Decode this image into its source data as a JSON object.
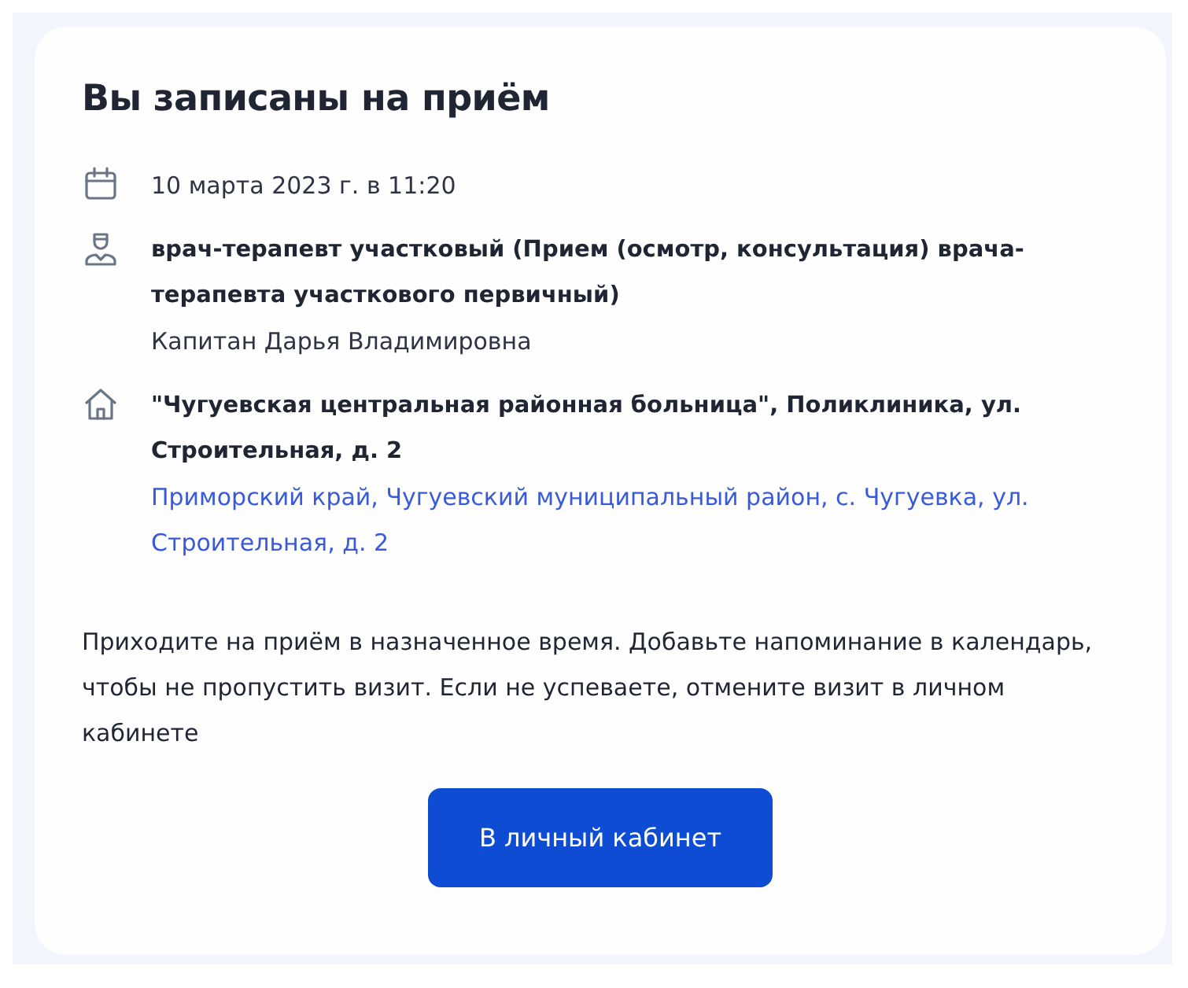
{
  "card": {
    "title": "Вы записаны на приём",
    "details": [
      {
        "kind": "date",
        "lines": [
          {
            "kind": "plain",
            "text": "10 марта 2023 г. в 11:20"
          }
        ]
      },
      {
        "kind": "doctor",
        "lines": [
          {
            "kind": "bold",
            "text": "врач-терапевт участковый (Прием (осмотр, консультация) врача-терапевта участкового первичный)"
          },
          {
            "kind": "plain",
            "text": "Капитан Дарья Владимировна"
          }
        ]
      },
      {
        "kind": "place",
        "lines": [
          {
            "kind": "bold",
            "text": "\"Чугуевская центральная районная больница\", Поликлиника, ул. Строительная, д. 2"
          },
          {
            "kind": "link",
            "text": "Приморский край, Чугуевский муниципальный район, с. Чугуевка, ул. Строительная, д. 2"
          }
        ]
      }
    ],
    "note": "Приходите на приём в назначенное время. Добавьте напоминание в календарь, чтобы не пропустить визит. Если не успеваете, отмените визит в личном кабинете",
    "button": "В личный кабинет"
  }
}
